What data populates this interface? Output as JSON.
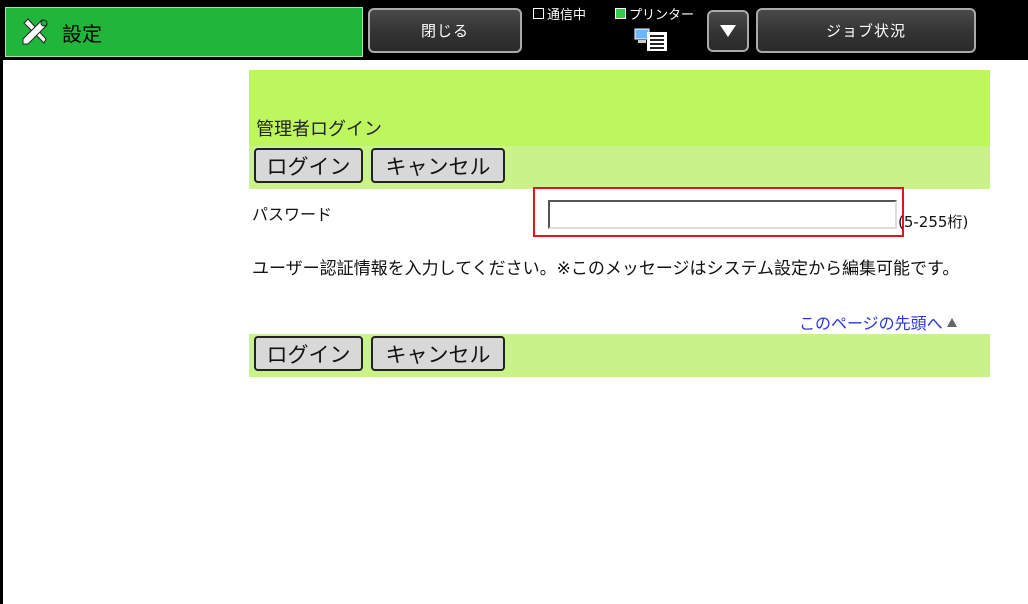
{
  "header": {
    "title": "設定",
    "close_label": "閉じる",
    "job_status_label": "ジョブ状況",
    "status_comm": "通信中",
    "status_printer": "プリンター"
  },
  "login": {
    "title": "管理者ログイン",
    "login_label": "ログイン",
    "cancel_label": "キャンセル",
    "password_label": "パスワード",
    "password_value": "",
    "password_hint": "(5-255桁)",
    "message": "ユーザー認証情報を入力してください。※このメッセージはシステム設定から編集可能です。",
    "top_link": "このページの先頭へ"
  },
  "colors": {
    "header_green": "#1fb63b",
    "band_green": "#bef65f",
    "highlight": "#e0161b",
    "link": "#2a35d8"
  }
}
